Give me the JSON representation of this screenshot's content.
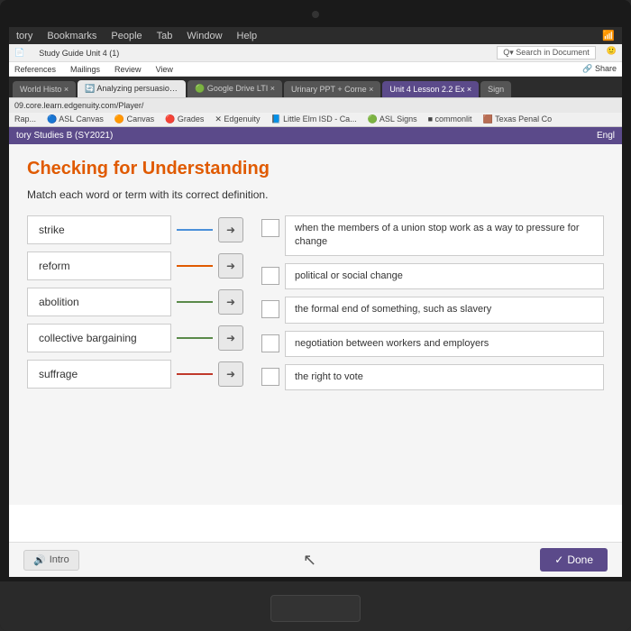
{
  "laptop": {
    "taskbar": {
      "items": [
        "tory",
        "Bookmarks",
        "People",
        "Tab",
        "Window",
        "Help"
      ]
    }
  },
  "browser": {
    "tabs": [
      {
        "label": "World Histo",
        "active": false
      },
      {
        "label": "Analyzing persuasion",
        "active": true
      },
      {
        "label": "Google Drive LTI",
        "active": false
      },
      {
        "label": "Urinary PPT + Corne",
        "active": false
      },
      {
        "label": "Unit 4 Lesson 2.2 Ex",
        "active": false
      },
      {
        "label": "Sign",
        "active": false
      }
    ],
    "address": "09.core.learn.edgenuity.com/Player/",
    "bookmarks": [
      "Rap...",
      "ASL Canvas",
      "Canvas",
      "Grades",
      "Edgenuity",
      "Little Elm ISD - Ca...",
      "ASL Signs",
      "commonlit",
      "Texas Penal Co"
    ]
  },
  "word_app": {
    "menu_items": [
      "References",
      "Mailings",
      "Review",
      "View"
    ],
    "document_title": "Study Guide Unit 4 (1)",
    "share_label": "Share"
  },
  "app_header": {
    "course": "tory Studies B (SY2021)",
    "lang": "Engl"
  },
  "page": {
    "title": "Checking for Understanding",
    "instruction": "Match each word or term with its correct definition."
  },
  "terms": [
    {
      "id": "strike",
      "label": "strike",
      "line_color": "blue"
    },
    {
      "id": "reform",
      "label": "reform",
      "line_color": "orange"
    },
    {
      "id": "abolition",
      "label": "abolition",
      "line_color": "green"
    },
    {
      "id": "collective_bargaining",
      "label": "collective bargaining",
      "line_color": "green"
    },
    {
      "id": "suffrage",
      "label": "suffrage",
      "line_color": "red"
    }
  ],
  "definitions": [
    {
      "id": "def1",
      "text": "when the members of a union stop work as a way to pressure for change"
    },
    {
      "id": "def2",
      "text": "political or social change"
    },
    {
      "id": "def3",
      "text": "the formal end of something, such as slavery"
    },
    {
      "id": "def4",
      "text": "negotiation between workers and employers"
    },
    {
      "id": "def5",
      "text": "the right to vote"
    }
  ],
  "buttons": {
    "intro": "Intro",
    "done": "Done"
  },
  "icons": {
    "speaker": "🔊",
    "arrow_right": "➜",
    "checkmark": "✓"
  }
}
